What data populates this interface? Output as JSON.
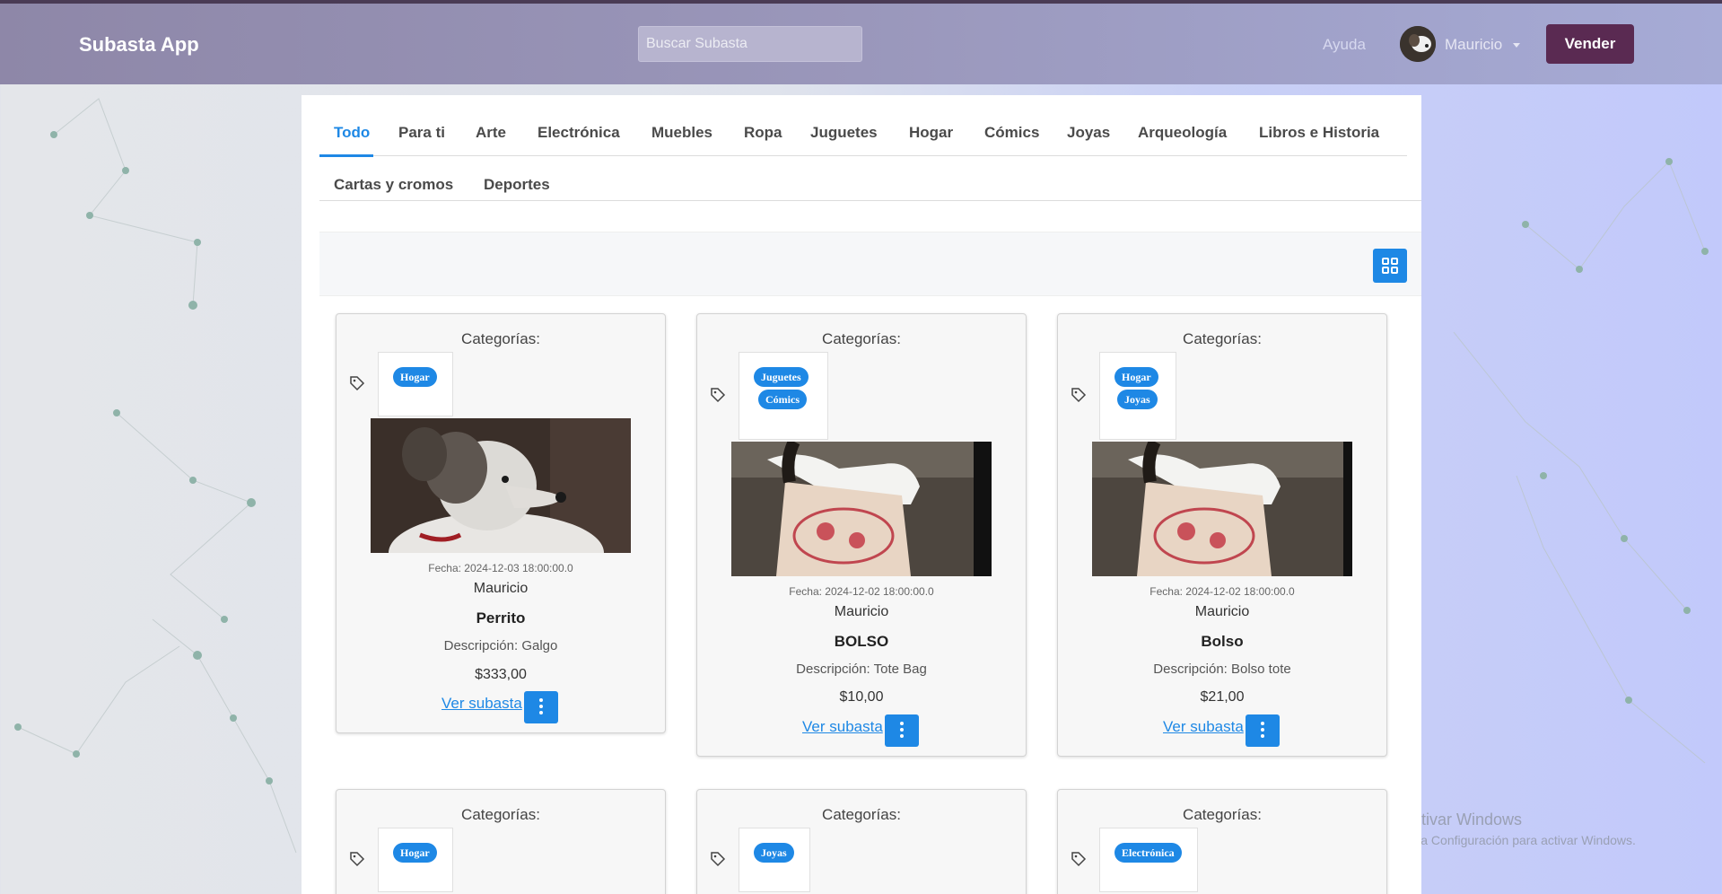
{
  "app": {
    "brand": "Subasta App"
  },
  "header": {
    "search_placeholder": "Buscar Subasta",
    "help_label": "Ayuda",
    "user_name": "Mauricio",
    "sell_label": "Vender"
  },
  "tabs": {
    "row1": [
      "Todo",
      "Para ti",
      "Arte",
      "Electrónica",
      "Muebles",
      "Ropa",
      "Juguetes",
      "Hogar",
      "Cómics",
      "Joyas",
      "Arqueología",
      "Libros e Historia"
    ],
    "row2": [
      "Cartas y cromos",
      "Deportes"
    ],
    "active": "Todo"
  },
  "cards": [
    {
      "title": "Categorías:",
      "categories": [
        "Hogar"
      ],
      "date": "Fecha: 2024-12-03 18:00:00.0",
      "author": "Mauricio",
      "name": "Perrito",
      "description": "Descripción: Galgo",
      "price": "$333,00",
      "link": "Ver subasta"
    },
    {
      "title": "Categorías:",
      "categories": [
        "Juguetes",
        "Cómics"
      ],
      "date": "Fecha: 2024-12-02 18:00:00.0",
      "author": "Mauricio",
      "name": "BOLSO",
      "description": "Descripción: Tote Bag",
      "price": "$10,00",
      "link": "Ver subasta"
    },
    {
      "title": "Categorías:",
      "categories": [
        "Hogar",
        "Joyas"
      ],
      "date": "Fecha: 2024-12-02 18:00:00.0",
      "author": "Mauricio",
      "name": "Bolso",
      "description": "Descripción: Bolso tote",
      "price": "$21,00",
      "link": "Ver subasta"
    },
    {
      "title": "Categorías:",
      "categories": [
        "Hogar"
      ]
    },
    {
      "title": "Categorías:",
      "categories": [
        "Joyas"
      ]
    },
    {
      "title": "Categorías:",
      "categories": [
        "Electrónica"
      ]
    }
  ],
  "watermark": {
    "line1": "Activar Windows",
    "line2": "Ve a Configuración para activar Windows."
  },
  "colors": {
    "accent": "#1e88e5",
    "sell_button": "#5a2a52",
    "navbar": "#9a97bb"
  }
}
